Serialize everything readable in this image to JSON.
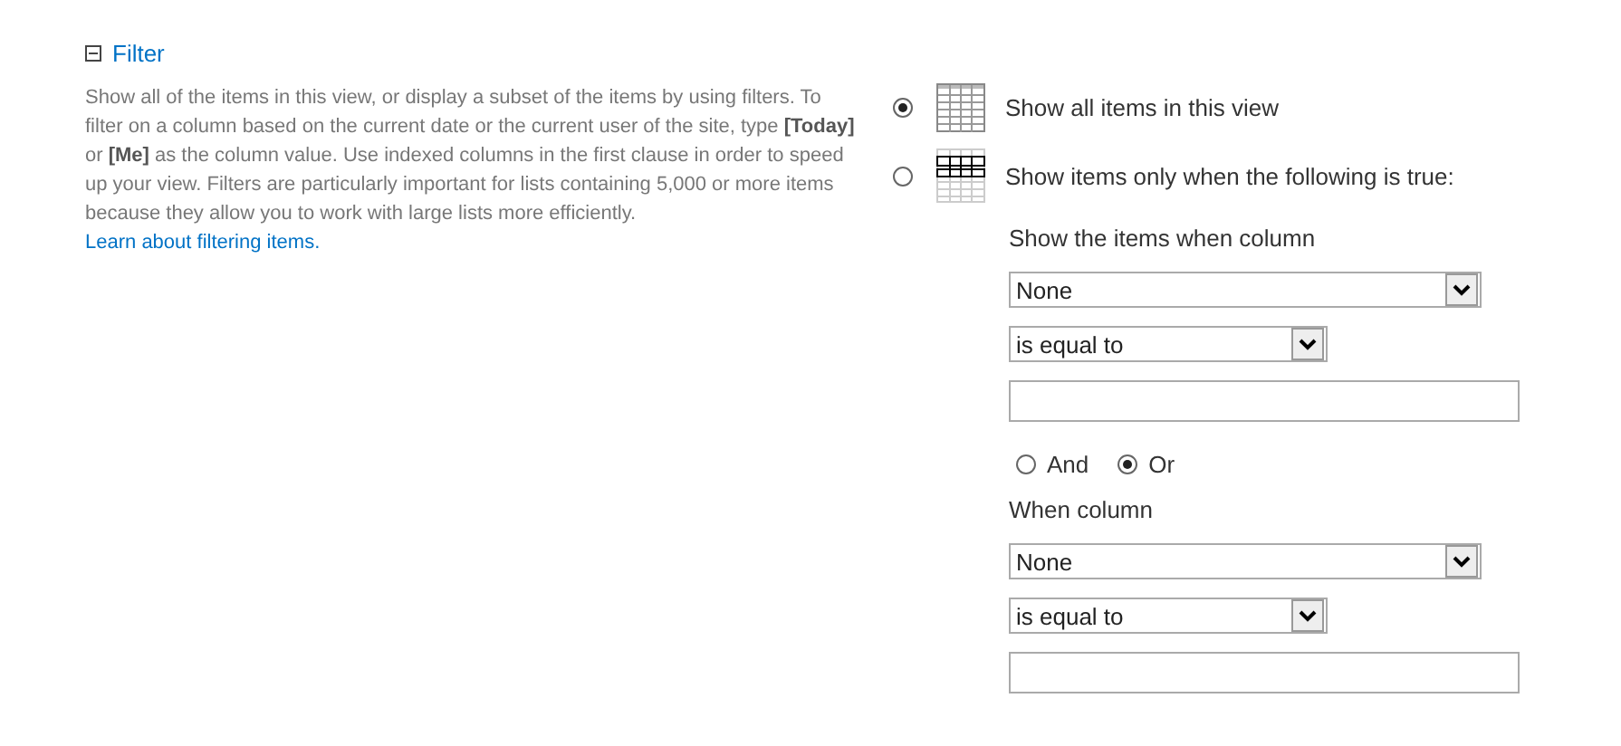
{
  "section": {
    "title": "Filter",
    "expanded": true,
    "description": "Show all of the items in this view, or display a subset of the items by using filters. To filter on a column based on the current date or the current user of the site, type **[Today]** or **[Me]** as the column value. Use indexed columns in the first clause in order to speed up your view. Filters are particularly important for lists containing 5,000 or more items because they allow you to work with large lists more efficiently.",
    "link": "Learn about filtering items."
  },
  "options": [
    {
      "kind": "all",
      "label": "Show all items in this view",
      "selected": true
    },
    {
      "kind": "filtered",
      "label": "Show items only when the following is true:",
      "selected": false
    }
  ],
  "conditions": [
    {
      "heading": "Show the items when column",
      "column": "None",
      "operator": "is equal to"
    },
    {
      "heading": "When column",
      "column": "None",
      "operator": "is equal to"
    }
  ],
  "connector": [
    {
      "label": "And",
      "selected": false
    },
    {
      "label": "Or",
      "selected": true
    }
  ]
}
